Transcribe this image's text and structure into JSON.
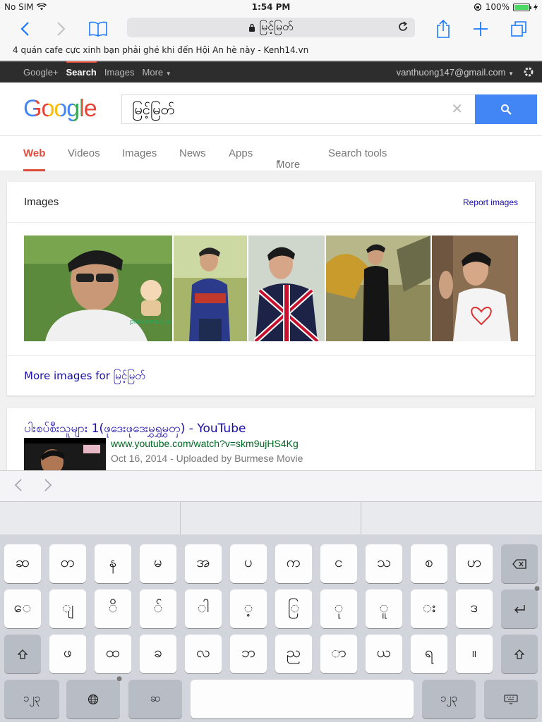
{
  "status": {
    "carrier": "No SIM",
    "time": "1:54 PM",
    "battery": "100%"
  },
  "browser": {
    "address": "မြင့်မြတ်",
    "tab_title": "4 quán cafe cực xinh bạn phải ghé khi đến Hội An hè này - Kenh14.vn"
  },
  "gbar": {
    "links": [
      "Google+",
      "Search",
      "Images",
      "More"
    ],
    "account": "vanthuong147@gmail.com"
  },
  "search": {
    "logo": "Google",
    "query": "မြင့်မြတ်"
  },
  "tabs": [
    "Web",
    "Videos",
    "Images",
    "News",
    "Apps",
    "More",
    "Search tools"
  ],
  "images_card": {
    "title": "Images",
    "report": "Report images",
    "more_link": "More images for မြင့်မြတ်",
    "watermark": "photomax.com"
  },
  "result": {
    "title": "ပါးစပ်စီးသူများ 1(ဖုဒေးဖုဒေးမွှရွှမွှတှ) - YouTube",
    "url": "www.youtube.com/watch?v=skm9ujHS4Kg",
    "meta": "Oct 16, 2014 - Uploaded by Burmese Movie"
  },
  "keyboard": {
    "row1": [
      "ဆ",
      "တ",
      "န",
      "မ",
      "အ",
      "ပ",
      "က",
      "င",
      "သ",
      "စ",
      "ဟ"
    ],
    "row2": [
      "ေ",
      "ျ",
      "ိ",
      "် ",
      "ါ",
      "့",
      "ြ",
      "ု",
      "ူ",
      "း",
      "ဒ"
    ],
    "row3": [
      "ဖ",
      "ထ",
      "ခ",
      "လ",
      "ဘ",
      "ည",
      "ာ",
      "ယ",
      "ရ",
      "။"
    ],
    "numbers_label": "၁၂၃",
    "space_label": "ဆ",
    "colors": {
      "accent": "#1a7aff",
      "google_blue": "#4285f4",
      "google_red": "#dd4b39"
    }
  }
}
